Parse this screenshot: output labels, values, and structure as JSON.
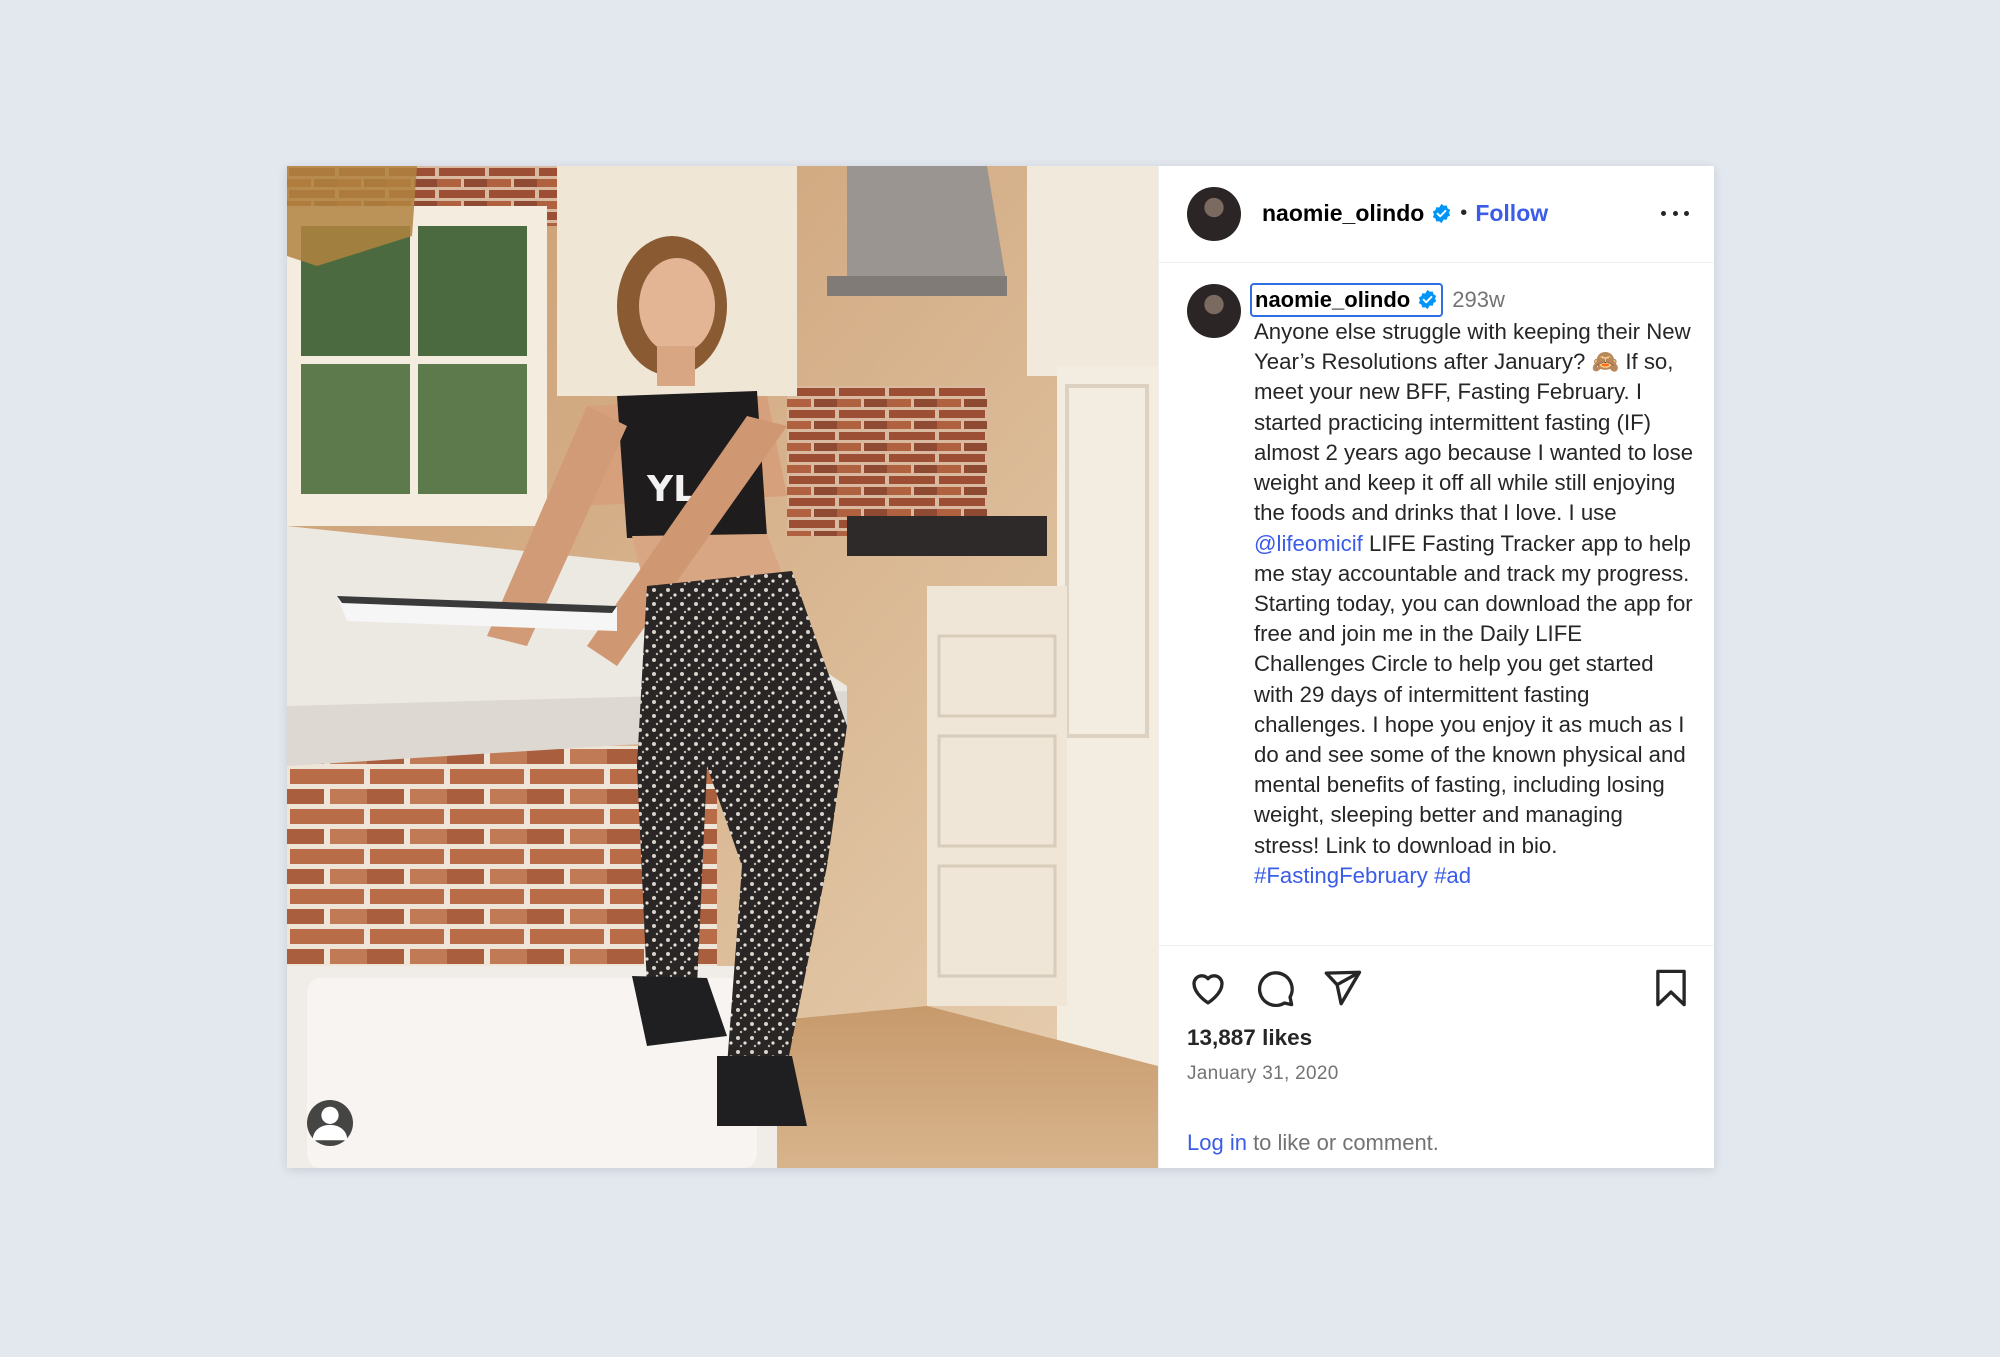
{
  "post": {
    "username": "naomie_olindo",
    "follow_label": "Follow",
    "separator": "•",
    "more_icon": "more-horizontal-icon",
    "verified_icon": "verified-badge-icon"
  },
  "caption": {
    "username": "naomie_olindo",
    "time": "293w",
    "text_part1": "Anyone else struggle with keeping their New Year’s Resolutions after January? 🙈 If so, meet your new BFF, Fasting February. I started practicing intermittent fasting (IF) almost 2 years ago because I wanted to lose weight and keep it off all while still enjoying the foods and drinks that I love. I use ",
    "mention": "@lifeomicif",
    "text_part2": " LIFE Fasting Tracker app to help me stay accountable and track my progress. Starting today, you can download the app for free and join me in the Daily LIFE Challenges Circle to help you get started with 29 days of intermittent fasting challenges. I hope you enjoy it as much as I do and see some of the known physical and mental benefits of fasting, including losing weight, sleeping better and managing stress! Link to download in bio. ",
    "hashtag1": "#FastingFebruary",
    "hashtag2": "#ad"
  },
  "actions": {
    "like_icon": "heart-icon",
    "comment_icon": "comment-icon",
    "share_icon": "share-icon",
    "save_icon": "bookmark-icon"
  },
  "likes": "13,887 likes",
  "date": "January 31, 2020",
  "login": {
    "link": "Log in",
    "rest": " to like or comment."
  },
  "media": {
    "tag_icon": "user-tag-icon"
  },
  "colors": {
    "link_blue": "#3a5ce8",
    "verified_blue": "#0095f6",
    "background": "#e3e8ef"
  }
}
